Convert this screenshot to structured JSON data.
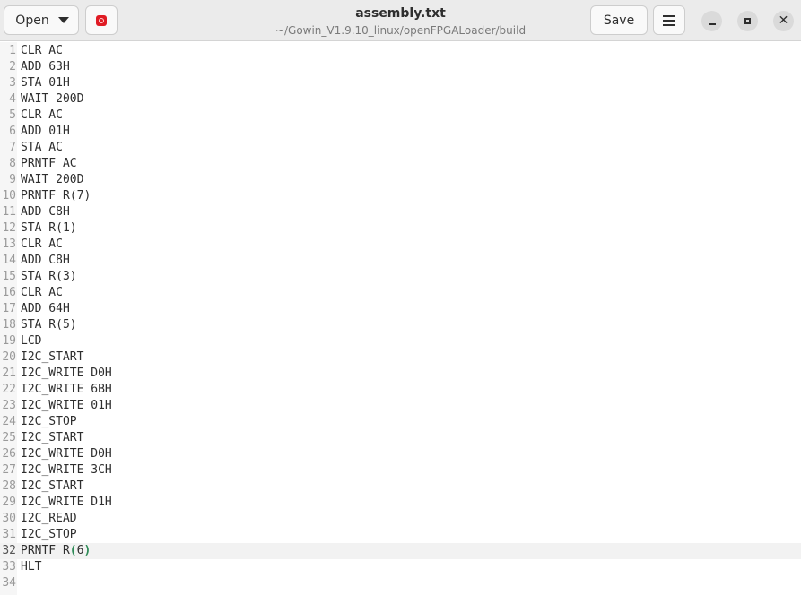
{
  "header": {
    "open_label": "Open",
    "title": "assembly.txt",
    "subtitle": "~/Gowin_V1.9.10_linux/openFPGALoader/build",
    "save_label": "Save",
    "close_glyph": "✕",
    "icons": [
      "chevron-down-icon",
      "record-icon",
      "hamburger-menu-icon",
      "minimize-icon",
      "maximize-icon",
      "close-icon"
    ],
    "accent_color": "#e01b24"
  },
  "editor": {
    "current_line": 32,
    "line_numbers": [
      "1",
      "2",
      "3",
      "4",
      "5",
      "6",
      "7",
      "8",
      "9",
      "10",
      "11",
      "12",
      "13",
      "14",
      "15",
      "16",
      "17",
      "18",
      "19",
      "20",
      "21",
      "22",
      "23",
      "24",
      "25",
      "26",
      "27",
      "28",
      "29",
      "30",
      "31",
      "32",
      "33",
      "34"
    ],
    "lines": [
      "CLR AC",
      "ADD 63H",
      "STA 01H",
      "WAIT 200D",
      "CLR AC",
      "ADD 01H",
      "STA AC",
      "PRNTF AC",
      "WAIT 200D",
      "PRNTF R(7)",
      "ADD C8H",
      "STA R(1)",
      "CLR AC",
      "ADD C8H",
      "STA R(3)",
      "CLR AC",
      "ADD 64H",
      "STA R(5)",
      "LCD",
      "I2C_START",
      "I2C_WRITE D0H",
      "I2C_WRITE 6BH",
      "I2C_WRITE 01H",
      "I2C_STOP",
      "I2C_START",
      "I2C_WRITE D0H",
      "I2C_WRITE 3CH",
      "I2C_START",
      "I2C_WRITE D1H",
      "I2C_READ",
      "I2C_STOP",
      "PRNTF R",
      "HLT",
      ""
    ],
    "current_line_parts": {
      "before": "PRNTF R",
      "open": "(",
      "inner": "6",
      "close": ")"
    }
  }
}
